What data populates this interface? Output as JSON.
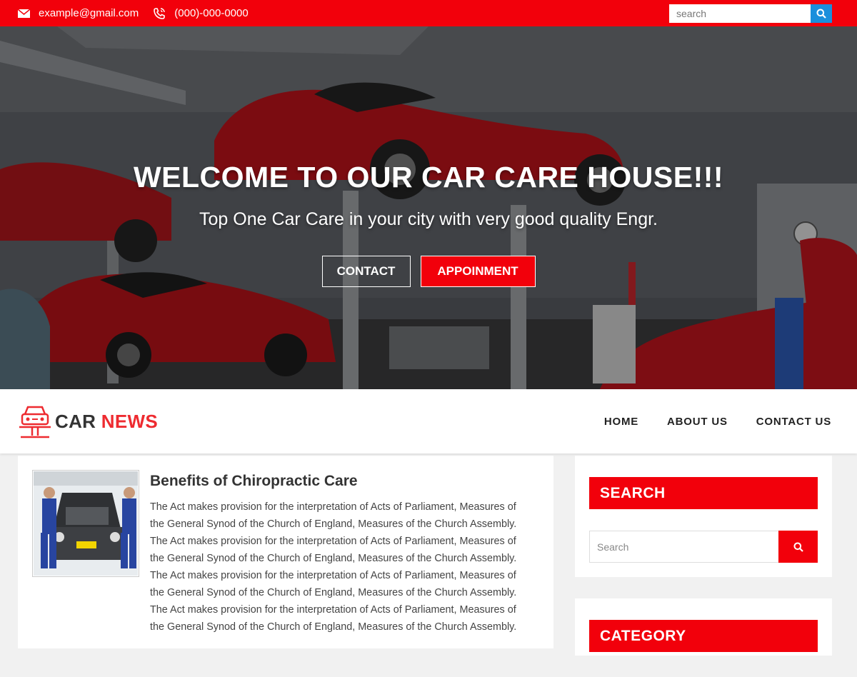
{
  "topbar": {
    "email": "example@gmail.com",
    "phone": "(000)-000-0000",
    "search_placeholder": "search",
    "email_icon": "mail-icon",
    "phone_icon": "phone-icon",
    "search_icon": "search-icon"
  },
  "hero": {
    "title": "WELCOME TO OUR CAR CARE HOUSE!!!",
    "subtitle": "Top One Car Care in your city with very good quality Engr.",
    "contact_label": "CONTACT",
    "appointment_label": "APPOINMENT"
  },
  "brand": {
    "word1": "CAR",
    "word2": "NEWS",
    "icon": "car-lift-icon"
  },
  "nav": {
    "items": [
      "HOME",
      "ABOUT US",
      "CONTACT US"
    ]
  },
  "post": {
    "title": "Benefits of Chiropractic Care",
    "lines": [
      "The Act makes provision for the interpretation of Acts of Parliament, Measures of",
      "the General Synod of the Church of England, Measures of the Church Assembly.",
      "The Act makes provision for the interpretation of Acts of Parliament, Measures of",
      "the General Synod of the Church of England, Measures of the Church Assembly.",
      "The Act makes provision for the interpretation of Acts of Parliament, Measures of",
      "the General Synod of the Church of England, Measures of the Church Assembly.",
      "The Act makes provision for the interpretation of Acts of Parliament, Measures of",
      "the General Synod of the Church of England, Measures of the Church Assembly."
    ]
  },
  "sidebar": {
    "search_title": "SEARCH",
    "search_placeholder": "Search",
    "category_title": "CATEGORY"
  },
  "colors": {
    "brand_red": "#f2000b",
    "search_blue": "#1a8fdc"
  }
}
